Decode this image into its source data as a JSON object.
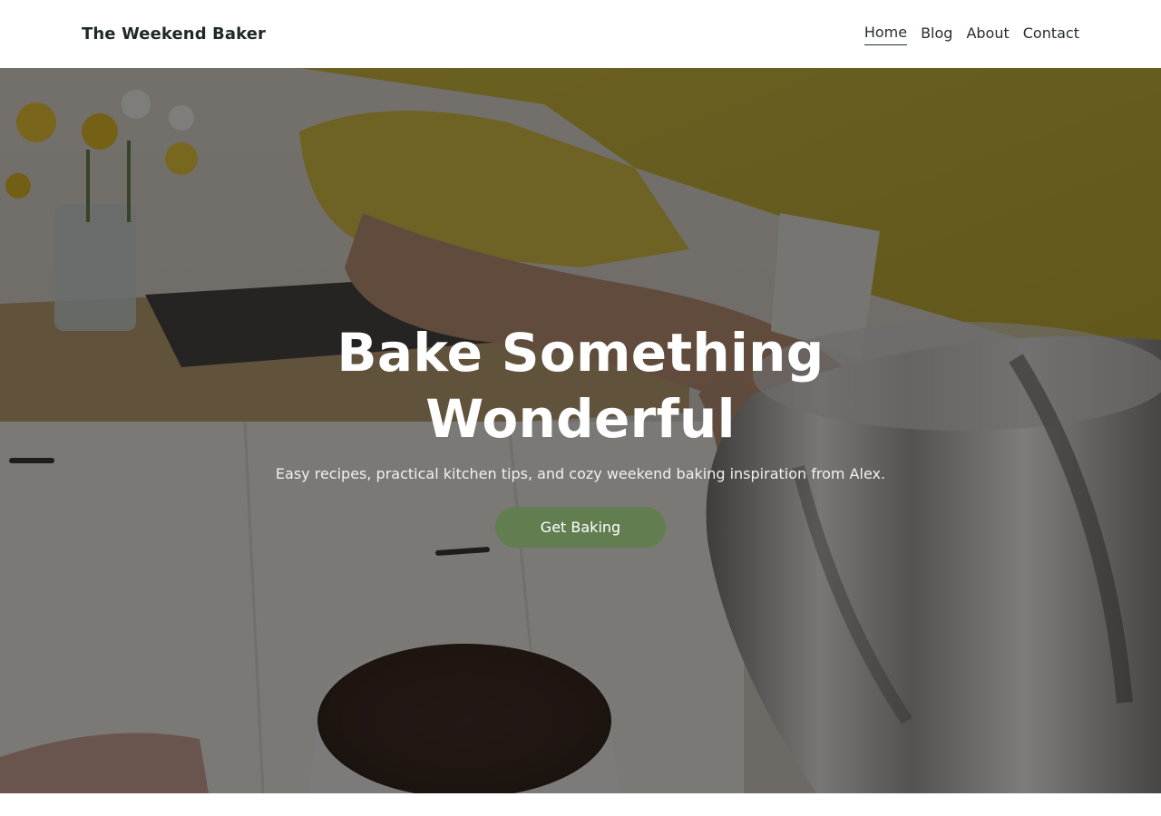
{
  "header": {
    "brand": "The Weekend Baker",
    "nav": [
      {
        "label": "Home",
        "active": true
      },
      {
        "label": "Blog",
        "active": false
      },
      {
        "label": "About",
        "active": false
      },
      {
        "label": "Contact",
        "active": false
      }
    ]
  },
  "hero": {
    "title": "Bake Something Wonderful",
    "subtitle": "Easy recipes, practical kitchen tips, and cozy weekend baking inspiration from Alex.",
    "cta_label": "Get Baking",
    "colors": {
      "cta_background": "#627e51",
      "overlay": "#141210"
    }
  }
}
